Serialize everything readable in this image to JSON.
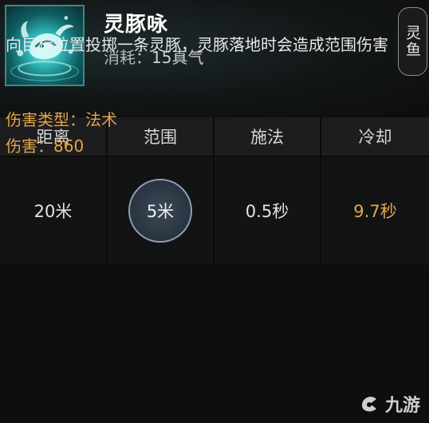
{
  "skill": {
    "name": "灵豚咏",
    "cost_label": "消耗：",
    "cost_value": "15真气",
    "tag": "灵鱼",
    "icon": "dolphin-splash-icon"
  },
  "stats": {
    "headers": [
      "距离",
      "范围",
      "施法",
      "冷却"
    ],
    "values": [
      "20米",
      "5米",
      "0.5秒",
      "9.7秒"
    ]
  },
  "description": "向目标位置投掷一条灵豚，灵豚落地时会造成范围伤害",
  "damage": {
    "type_label": "伤害类型：",
    "type_value": "法术",
    "value_label": "伤害：",
    "value": "860"
  },
  "colors": {
    "accent_gold": "#e3a64c",
    "icon_teal": "#2fb2b4"
  },
  "watermark": {
    "text": "九游",
    "icon": "nine-game-logo-icon"
  }
}
